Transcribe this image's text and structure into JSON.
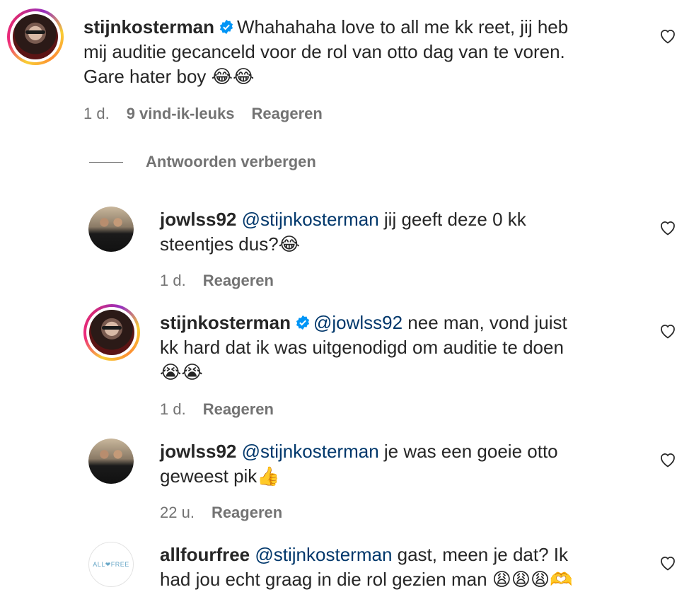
{
  "comments": [
    {
      "username": "stijnkosterman",
      "verified": true,
      "mention": "",
      "text_line1": "Whahahaha love to all me kk reet, jij heb",
      "text_line2": "mij auditie gecanceld voor de rol van otto dag van te voren.",
      "text_line3": "Gare hater boy 😂😂",
      "time": "1 d.",
      "likes": "9 vind-ik-leuks",
      "reply": "Reageren"
    },
    {
      "username": "jowlss92",
      "mention": "@stijnkosterman",
      "text_a": "jij geeft deze 0 kk",
      "text_b": "steentjes dus?😂",
      "time": "1 d.",
      "reply": "Reageren"
    },
    {
      "username": "stijnkosterman",
      "verified": true,
      "mention": "@jowlss92",
      "text_a": "nee man, vond juist",
      "text_b": "kk hard dat ik was uitgenodigd om auditie te doen",
      "text_c": "😭😭",
      "time": "1 d.",
      "reply": "Reageren"
    },
    {
      "username": "jowlss92",
      "mention": "@stijnkosterman",
      "text_a": "je was een goeie otto",
      "text_b": "geweest pik👍",
      "time": "22 u.",
      "reply": "Reageren"
    },
    {
      "username": "allfourfree",
      "mention": "@stijnkosterman",
      "text_a": "gast, meen je dat? Ik",
      "text_b": "had jou echt graag in die rol gezien man 😩😩😩🫶"
    }
  ],
  "hide_replies_label": "Antwoorden verbergen",
  "allfourfree_logo": "ALL❤FREE",
  "colors": {
    "mention": "#00376b",
    "meta": "#737373",
    "verified": "#0095f6"
  }
}
